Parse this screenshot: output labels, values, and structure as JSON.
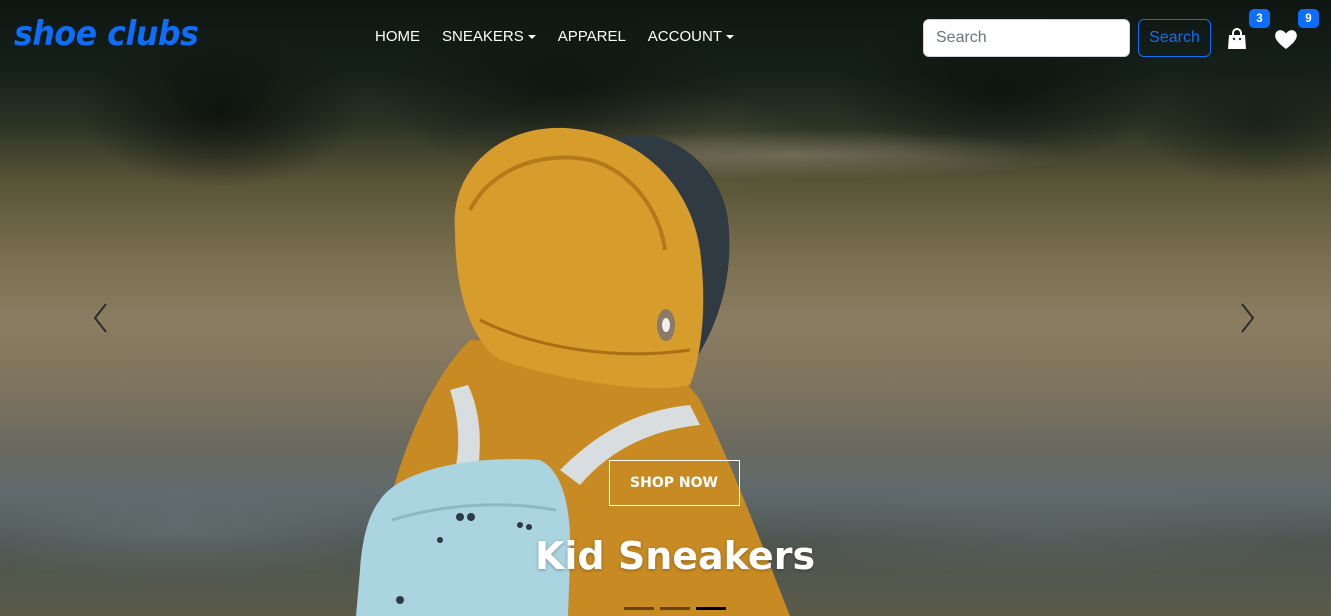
{
  "brand": {
    "name": "shoe clubs"
  },
  "nav": {
    "items": [
      {
        "label": "HOME",
        "dropdown": false
      },
      {
        "label": "SNEAKERS",
        "dropdown": true
      },
      {
        "label": "APPAREL",
        "dropdown": false
      },
      {
        "label": "ACCOUNT",
        "dropdown": true
      }
    ]
  },
  "search": {
    "placeholder": "Search",
    "value": "",
    "button_label": "Search"
  },
  "cart": {
    "icon": "shopping-bag-icon",
    "count": "3"
  },
  "wishlist": {
    "icon": "heart-icon",
    "count": "9"
  },
  "carousel": {
    "prev_icon": "chevron-left-icon",
    "next_icon": "chevron-right-icon",
    "slide": {
      "button_label": "SHOP NOW",
      "title": "Kid Sneakers"
    },
    "indicator_count": 3,
    "active_indicator": 2
  },
  "colors": {
    "accent": "#0d6efd",
    "nav_text": "#ffffff",
    "jacket": "#d49a2a"
  }
}
